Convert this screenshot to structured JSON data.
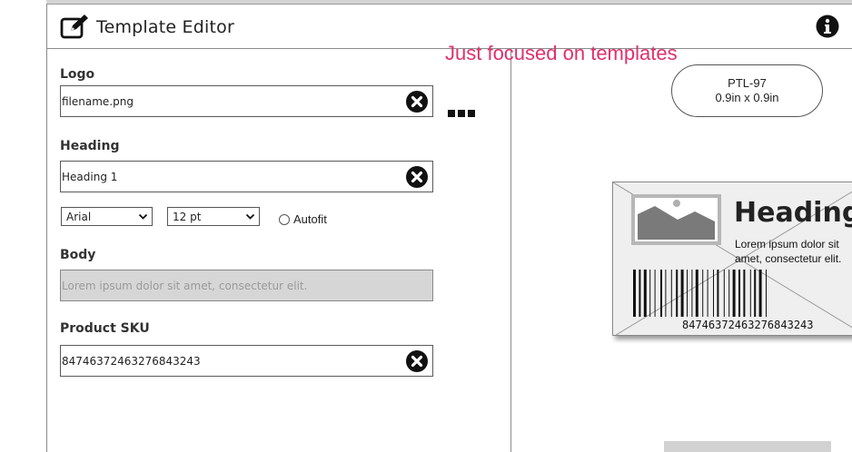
{
  "header": {
    "title": "Template Editor",
    "edit_icon": "edit-icon",
    "info_icon": "info-icon"
  },
  "annotation": "Just focused on templates",
  "form": {
    "logo": {
      "label": "Logo",
      "value": "filename.png",
      "clear_icon": "close-circle-icon"
    },
    "heading": {
      "label": "Heading",
      "value": "Heading 1",
      "clear_icon": "close-circle-icon"
    },
    "font_select": {
      "value": "Arial"
    },
    "size_select": {
      "value": "12 pt"
    },
    "autofit": {
      "label": "Autofit",
      "checked": false
    },
    "body": {
      "label": "Body",
      "placeholder": "Lorem ipsum dolor sit amet, consectetur elit."
    },
    "sku": {
      "label": "Product SKU",
      "value": "84746372463276843243",
      "clear_icon": "close-circle-icon"
    }
  },
  "more_icon": "more-dots-icon",
  "preview": {
    "template_pill": {
      "code": "PTL-97",
      "size": "0.9in x 0.9in"
    },
    "label": {
      "image_icon": "image-placeholder-icon",
      "heading": "Heading",
      "body": "Lorem ipsum dolor sit amet, consectetur elit.",
      "sku": "84746372463276843243"
    }
  },
  "colors": {
    "annotation": "#e0306b",
    "border": "#5a5a5a",
    "disabled_field": "#d6d6d6"
  }
}
